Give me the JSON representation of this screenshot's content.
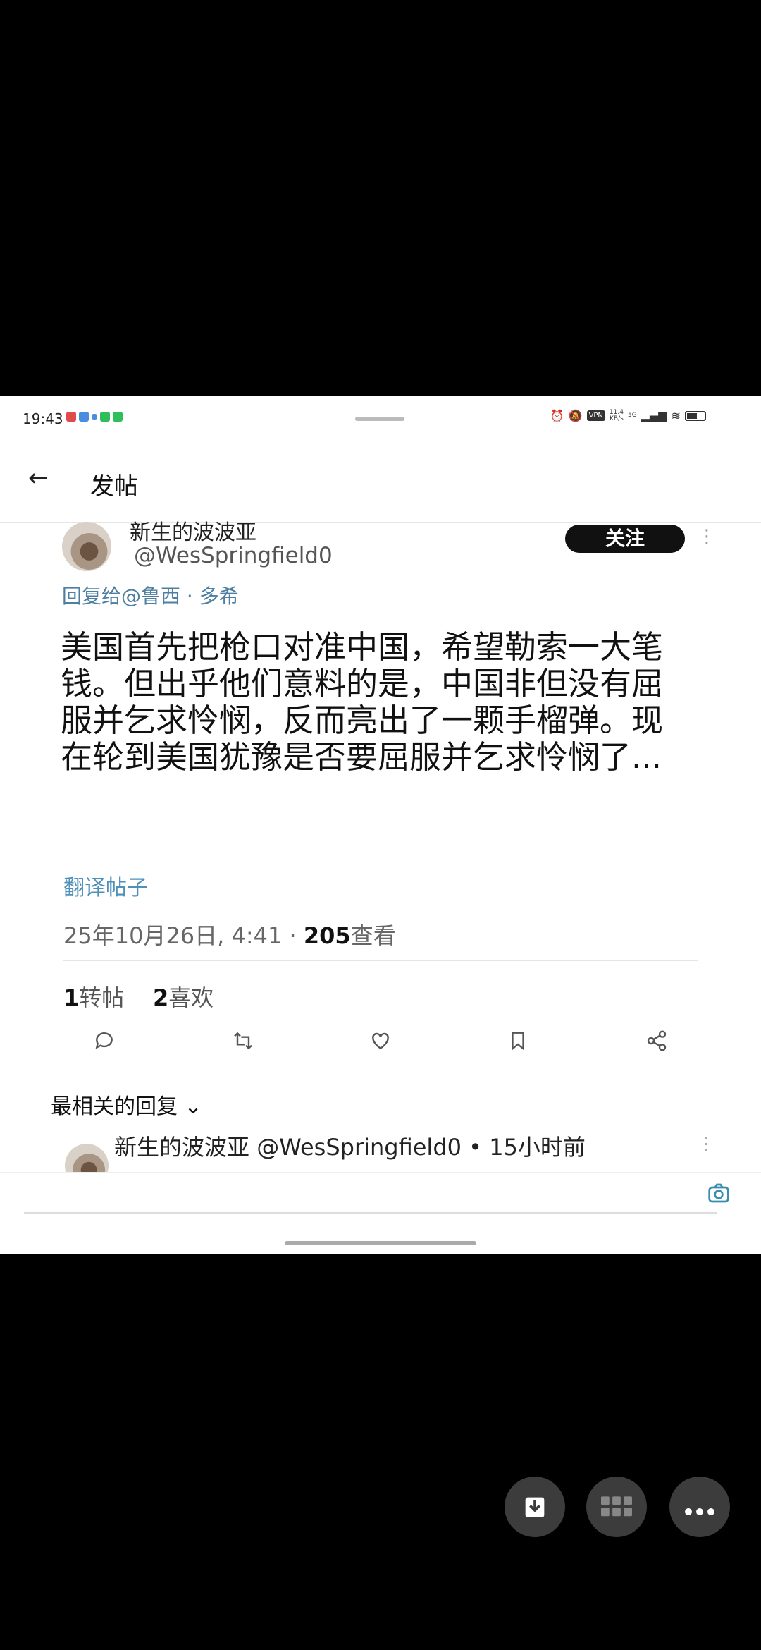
{
  "status": {
    "time": "19:43",
    "vpn": "VPN",
    "speed_value": "11.4",
    "speed_unit": "KB/s",
    "network": "5G"
  },
  "topbar": {
    "back_icon": "←",
    "title": "发帖"
  },
  "post": {
    "author_name": "新生的波波亚",
    "author_handle": "@WesSpringfield0",
    "follow_label": "关注",
    "reply_to": "回复给@鲁西 · 多希",
    "text": "美国首先把枪口对准中国，希望勒索一大笔钱。但出乎他们意料的是，中国非但没有屈服并乞求怜悯，反而亮出了一颗手榴弹。现在轮到美国犹豫是否要屈服并乞求怜悯了...",
    "translate_label": "翻译帖子",
    "timestamp": "25年10月26日, 4:41",
    "views_count": "205",
    "views_label": "查看",
    "reposts_count": "1",
    "reposts_label": "转帖",
    "likes_count": "2",
    "likes_label": "喜欢"
  },
  "actions": {
    "reply_icon": "comment-icon",
    "repost_icon": "repost-icon",
    "like_icon": "heart-icon",
    "bookmark_icon": "bookmark-icon",
    "share_icon": "share-icon"
  },
  "replies": {
    "header": "最相关的回复 ⌄",
    "first_reply": {
      "name": "新生的波波亚",
      "handle": "@WesSpringfield0",
      "time": "• 15小时前"
    }
  },
  "colors": {
    "accent": "#4e90b8",
    "follow_bg": "#111111",
    "fab_bg": "#3c3c3c"
  }
}
